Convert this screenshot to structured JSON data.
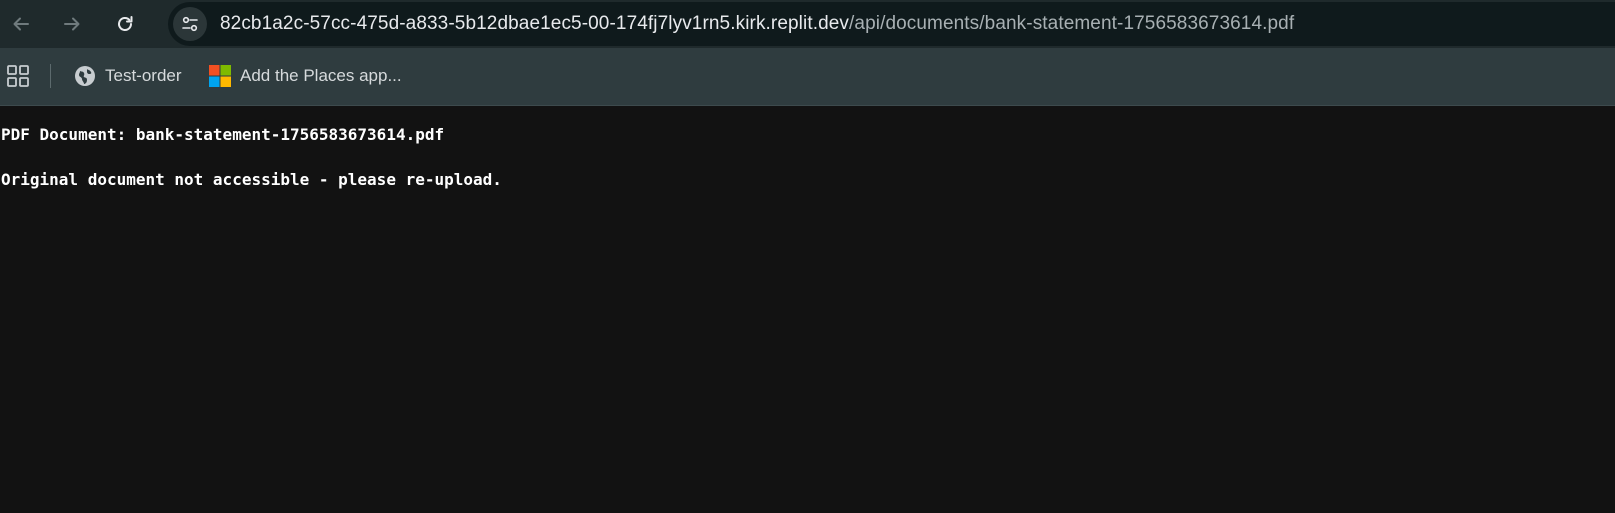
{
  "browser": {
    "address_bar": {
      "host": "82cb1a2c-57cc-475d-a833-5b12dbae1ec5-00-174fj7lyv1rn5.kirk.replit.dev",
      "path": "/api/documents/bank-statement-1756583673614.pdf"
    },
    "bookmarks": [
      {
        "label": "Test-order",
        "icon": "globe-icon"
      },
      {
        "label": "Add the Places app...",
        "icon": "microsoft-logo-icon"
      }
    ]
  },
  "page": {
    "heading": "PDF Document: bank-statement-1756583673614.pdf",
    "message": "Original document not accessible - please re-upload."
  },
  "colors": {
    "page_background": "#121212",
    "toolbar_background": "#1f2a2c",
    "bookmarks_background": "#2f3c3f"
  }
}
